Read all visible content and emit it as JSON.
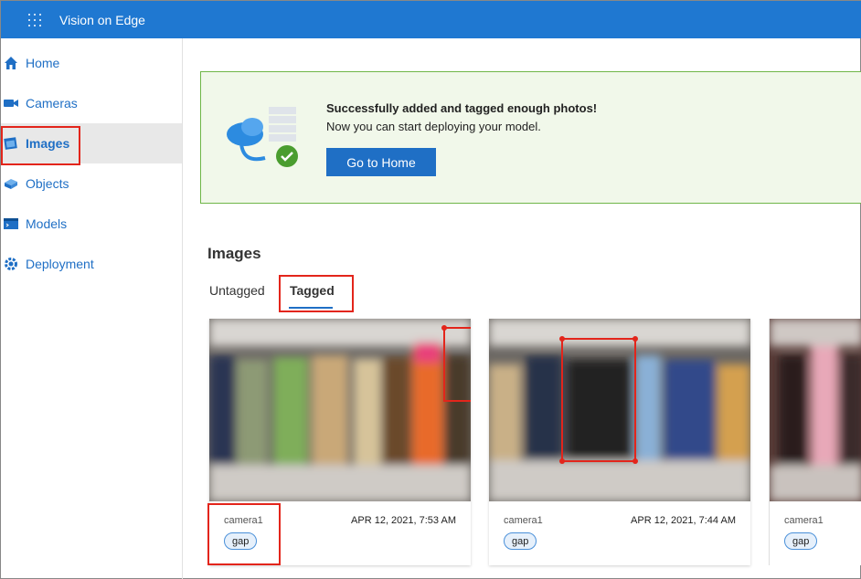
{
  "app": {
    "title": "Vision on Edge"
  },
  "sidebar": {
    "items": [
      {
        "label": "Home",
        "icon": "home-icon"
      },
      {
        "label": "Cameras",
        "icon": "camera-icon"
      },
      {
        "label": "Images",
        "icon": "images-icon",
        "active": true
      },
      {
        "label": "Objects",
        "icon": "objects-icon"
      },
      {
        "label": "Models",
        "icon": "models-icon"
      },
      {
        "label": "Deployment",
        "icon": "deployment-icon"
      }
    ]
  },
  "banner": {
    "title": "Successfully added and tagged enough photos!",
    "subtitle": "Now you can start deploying your model.",
    "button": "Go to Home"
  },
  "images": {
    "title": "Images",
    "tabs": [
      {
        "label": "Untagged"
      },
      {
        "label": "Tagged",
        "active": true
      }
    ],
    "cards": [
      {
        "camera": "camera1",
        "date": "APR 12, 2021, 7:53 AM",
        "tag": "gap"
      },
      {
        "camera": "camera1",
        "date": "APR 12, 2021, 7:44 AM",
        "tag": "gap"
      },
      {
        "camera": "camera1",
        "date": "",
        "tag": "gap"
      }
    ]
  },
  "colors": {
    "accent": "#1f6fc5",
    "highlight": "#e3251b",
    "success": "#6fb648"
  }
}
